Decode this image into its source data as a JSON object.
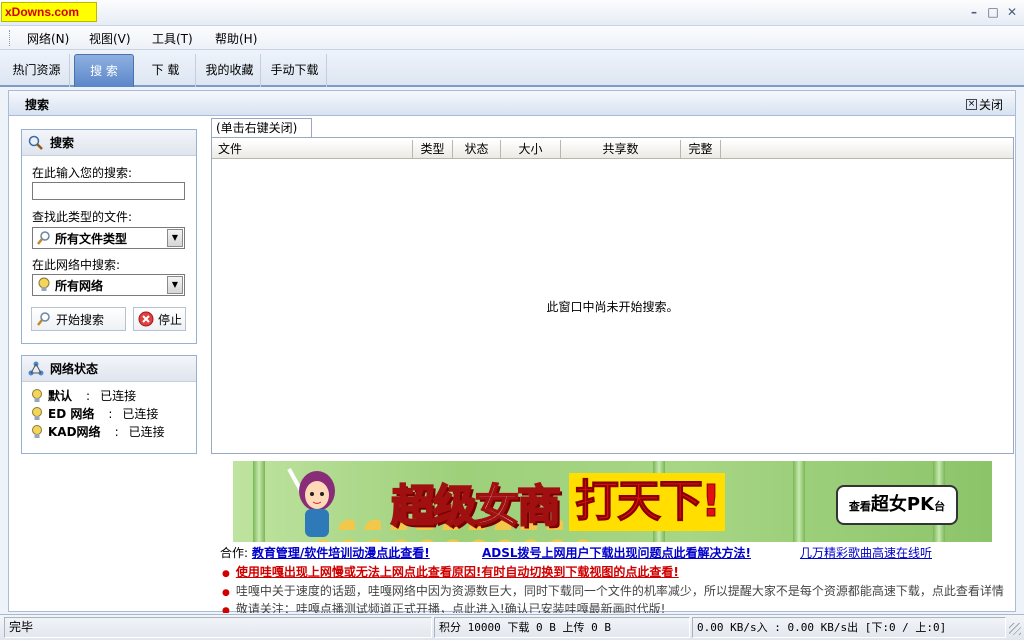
{
  "app": {
    "logo_text": "xDowns.com"
  },
  "window_controls": {
    "minimize": "–",
    "maximize": "□",
    "close": "✕"
  },
  "menu": [
    {
      "label": "网络(N)"
    },
    {
      "label": "视图(V)"
    },
    {
      "label": "工具(T)"
    },
    {
      "label": "帮助(H)"
    }
  ],
  "tabs": [
    {
      "label": "热门资源",
      "active": false
    },
    {
      "label": "搜 索",
      "active": true
    },
    {
      "label": "下 载",
      "active": false
    },
    {
      "label": "我的收藏",
      "active": false
    },
    {
      "label": "手动下载",
      "active": false
    }
  ],
  "section": {
    "title": "搜索",
    "close_label": "关闭"
  },
  "search_panel": {
    "title": "搜索",
    "input_label": "在此输入您的搜索:",
    "input_value": "",
    "filetype_label": "查找此类型的文件:",
    "filetype_value": "所有文件类型",
    "network_label": "在此网络中搜索:",
    "network_value": "所有网络",
    "start_button": "开始搜索",
    "stop_button": "停止"
  },
  "network_panel": {
    "title": "网络状态",
    "rows": [
      {
        "name": "默认",
        "sep": ":",
        "status": "已连接"
      },
      {
        "name": "ED 网络",
        "sep": ":",
        "status": "已连接"
      },
      {
        "name": "KAD网络",
        "sep": ":",
        "status": "已连接"
      }
    ]
  },
  "results": {
    "tab_label": "(单击右键关闭)",
    "columns": [
      "文件",
      "类型",
      "状态",
      "大小",
      "共享数",
      "完整"
    ],
    "empty_message": "此窗口中尚未开始搜索。"
  },
  "banner": {
    "headline_left": "超级女商",
    "headline_right": "打天下!",
    "badge_prefix": "查看",
    "badge_bold": "超女PK",
    "badge_suffix": "台"
  },
  "news": {
    "partner_label": "合作:",
    "partner_link1": "教育管理/软件培训动漫点此查看!",
    "partner_link2": "ADSL拨号上网用户下载出现问题点此看解决方法!",
    "partner_link3": "几万精彩歌曲高速在线听",
    "line1": "使用哇嘎出现上网慢或无法上网点此查看原因!有时自动切换到下载视图的点此查看!",
    "line2": "哇嘎中关于速度的话题，哇嘎网络中因为资源数巨大，同时下载同一个文件的机率减少，所以提醒大家不是每个资源都能高速下载，点此查看详情",
    "line3": "敬请关注：哇嘎点播测试频道正式开播，点此进入!确认已安装哇嘎最新画时代版!"
  },
  "statusbar": {
    "status": "完毕",
    "points": "积分 10000 下载 0 B 上传 0 B",
    "speed": "0.00 KB/s入 : 0.00 KB/s出 [下:0 / 上:0]"
  },
  "colors": {
    "accent": "#5a86c9",
    "link": "#0000cc",
    "link_red": "#d00000",
    "logo_bg": "#ffff00"
  }
}
